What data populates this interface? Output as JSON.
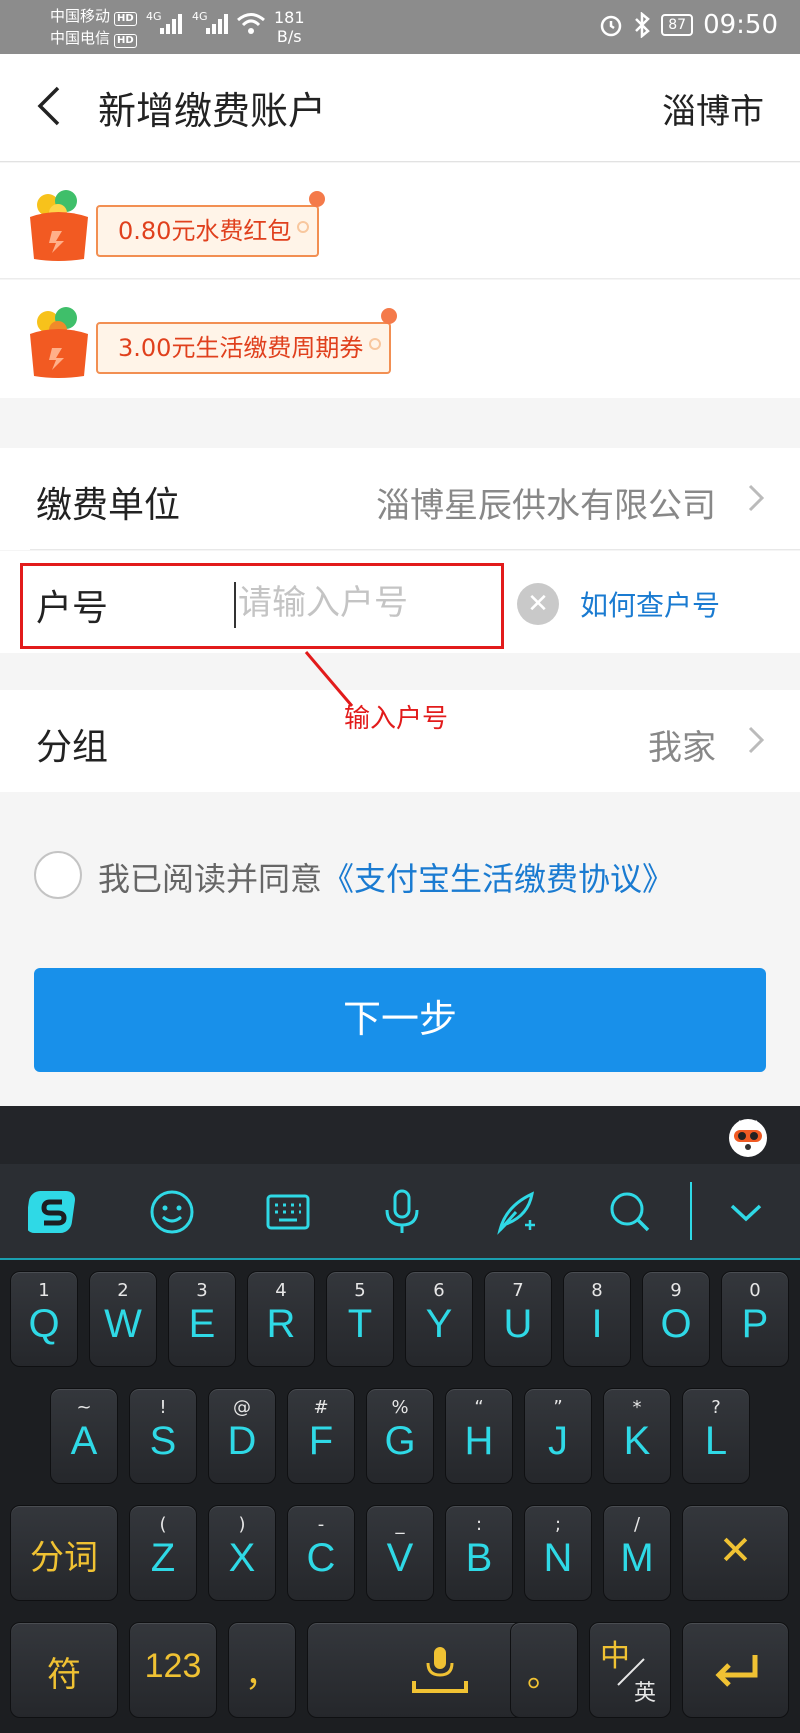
{
  "status_bar": {
    "carrier1": "中国移动",
    "carrier2": "中国电信",
    "hd": "HD",
    "net": "4G",
    "speed_value": "181",
    "speed_unit": "B/s",
    "battery": "87",
    "time": "09:50"
  },
  "header": {
    "title": "新增缴费账户",
    "city": "淄博市"
  },
  "coupons": [
    {
      "label": "0.80元水费红包"
    },
    {
      "label": "3.00元生活缴费周期券"
    }
  ],
  "form": {
    "payee_label": "缴费单位",
    "payee_value": "淄博星辰供水有限公司",
    "account_label": "户号",
    "account_placeholder": "请输入户号",
    "account_value": "",
    "how_to": "如何查户号",
    "group_label": "分组",
    "group_value": "我家"
  },
  "annotation": "输入户号",
  "agreement": {
    "text": "我已阅读并同意",
    "link": "《支付宝生活缴费协议》"
  },
  "next_button": "下一步",
  "keyboard": {
    "toolbar_icons": [
      "sogou-logo-icon",
      "emoji-icon",
      "keyboard-layout-icon",
      "microphone-icon",
      "handwriting-pen-icon",
      "search-icon",
      "collapse-chevron-icon"
    ],
    "row1": [
      {
        "sup": "1",
        "key": "Q"
      },
      {
        "sup": "2",
        "key": "W"
      },
      {
        "sup": "3",
        "key": "E"
      },
      {
        "sup": "4",
        "key": "R"
      },
      {
        "sup": "5",
        "key": "T"
      },
      {
        "sup": "6",
        "key": "Y"
      },
      {
        "sup": "7",
        "key": "U"
      },
      {
        "sup": "8",
        "key": "I"
      },
      {
        "sup": "9",
        "key": "O"
      },
      {
        "sup": "0",
        "key": "P"
      }
    ],
    "row2": [
      {
        "sup": "~",
        "key": "A"
      },
      {
        "sup": "!",
        "key": "S"
      },
      {
        "sup": "@",
        "key": "D"
      },
      {
        "sup": "#",
        "key": "F"
      },
      {
        "sup": "%",
        "key": "G"
      },
      {
        "sup": "“",
        "key": "H"
      },
      {
        "sup": "”",
        "key": "J"
      },
      {
        "sup": "*",
        "key": "K"
      },
      {
        "sup": "?",
        "key": "L"
      }
    ],
    "row3": [
      {
        "sup": "(",
        "key": "Z"
      },
      {
        "sup": ")",
        "key": "X"
      },
      {
        "sup": "-",
        "key": "C"
      },
      {
        "sup": "_",
        "key": "V"
      },
      {
        "sup": ":",
        "key": "B"
      },
      {
        "sup": ";",
        "key": "N"
      },
      {
        "sup": "/",
        "key": "M"
      }
    ],
    "fenci": "分词",
    "delete": "✕",
    "symbols": "符",
    "numbers": "123",
    "comma": "，",
    "period": "。",
    "lang_zh": "中",
    "lang_en": "英",
    "enter": "↵"
  }
}
